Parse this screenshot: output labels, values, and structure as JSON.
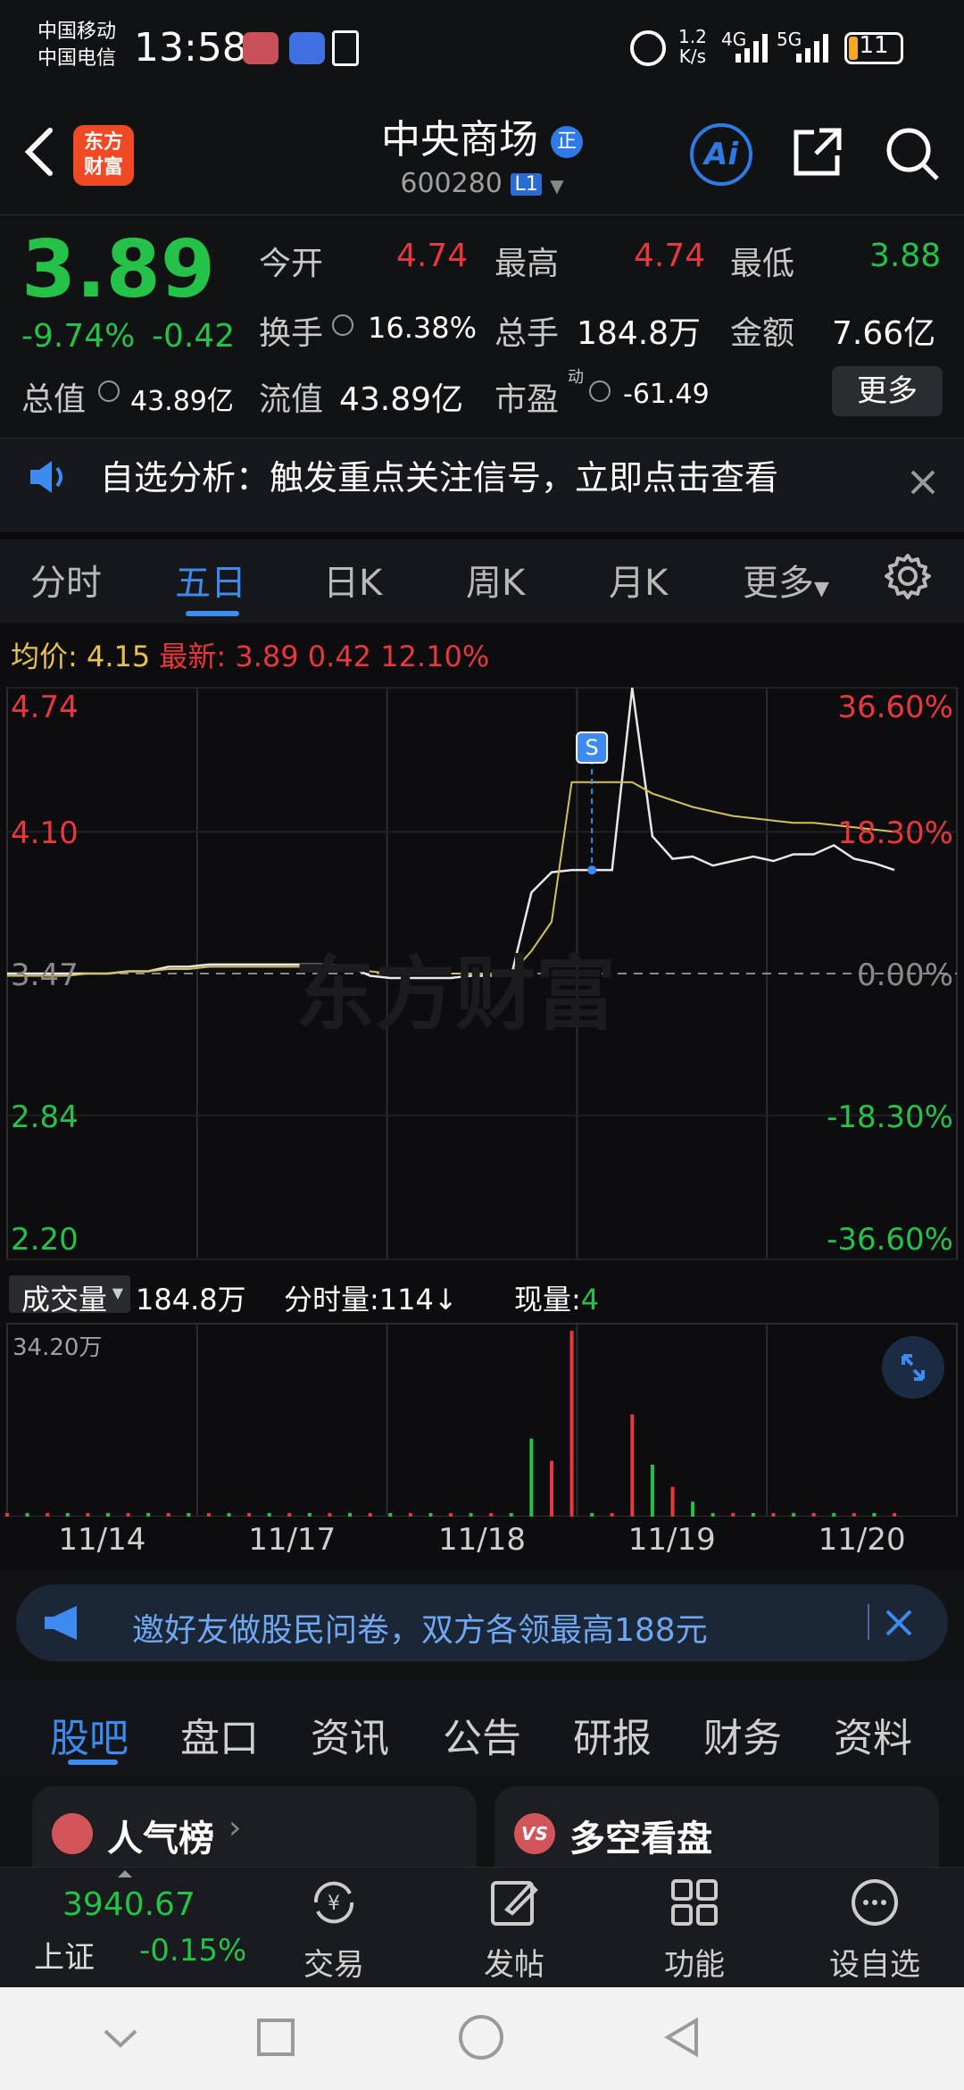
{
  "status_bar": {
    "carrier1": "中国移动",
    "carrier2": "中国电信",
    "time": "13:58",
    "net_speed_top": "1.2",
    "net_speed_bottom": "K/s",
    "net1": "4G",
    "net2": "5G",
    "battery": "11"
  },
  "header": {
    "logo_line1": "东方",
    "logo_line2": "财富",
    "title": "中央商场",
    "title_badge": "正",
    "code": "600280",
    "level_badge": "L1",
    "ai_label": "Ai"
  },
  "quote": {
    "price": "3.89",
    "change_pct": "-9.74%",
    "change_val": "-0.42",
    "open_label": "今开",
    "open": "4.74",
    "high_label": "最高",
    "high": "4.74",
    "low_label": "最低",
    "low": "3.88",
    "turnover_label": "换手",
    "turnover": "16.38%",
    "volume_label": "总手",
    "volume": "184.8万",
    "amount_label": "金额",
    "amount": "7.66亿",
    "total_mv_label": "总值",
    "total_mv": "43.89亿",
    "float_mv_label": "流值",
    "float_mv": "43.89亿",
    "pe_label": "市盈",
    "pe_sup": "动",
    "pe": "-61.49",
    "more_button": "更多"
  },
  "notice": {
    "text": "自选分析：触发重点关注信号，立即点击查看"
  },
  "chart_tabs": [
    "分时",
    "五日",
    "日K",
    "周K",
    "月K",
    "更多"
  ],
  "chart_info": {
    "avg_label": "均价:",
    "avg": "4.15",
    "latest_label": "最新:",
    "latest": "3.89",
    "latest_chg": "0.42",
    "latest_pct": "12.10%"
  },
  "chart_data": {
    "type": "line",
    "title": "",
    "x": [
      "11/14",
      "11/17",
      "11/18",
      "11/19",
      "11/20"
    ],
    "y_left_ticks": [
      "4.74",
      "4.10",
      "3.47",
      "2.84",
      "2.20"
    ],
    "y_right_ticks": [
      "36.60%",
      "18.30%",
      "0.00%",
      "-18.30%",
      "-36.60%"
    ],
    "ylim": [
      2.2,
      4.74
    ],
    "baseline": 3.47,
    "grid": true,
    "series": [
      {
        "color": "#e8e8e8",
        "values": [
          3.47,
          3.47,
          3.47,
          3.47,
          3.47,
          3.47,
          3.48,
          3.48,
          3.5,
          3.5,
          3.51,
          3.51,
          3.51,
          3.51,
          3.51,
          3.51,
          3.51,
          3.5,
          3.46,
          3.45,
          3.45,
          3.45,
          3.45,
          3.46,
          3.46,
          3.46,
          3.83,
          3.92,
          3.93,
          3.93,
          3.93,
          4.74,
          4.08,
          3.98,
          3.99,
          3.95,
          3.97,
          3.99,
          3.97,
          4.0,
          4.0,
          4.04,
          3.98,
          3.96,
          3.93
        ]
      },
      {
        "color": "#d4c25a",
        "values": [
          3.46,
          3.46,
          3.46,
          3.46,
          3.47,
          3.47,
          3.48,
          3.48,
          3.49,
          3.49,
          3.5,
          3.5,
          3.5,
          3.5,
          3.5,
          3.5,
          3.5,
          3.5,
          3.48,
          3.47,
          3.47,
          3.47,
          3.47,
          3.47,
          3.47,
          3.47,
          3.57,
          3.7,
          4.32,
          4.32,
          4.32,
          4.32,
          4.27,
          4.24,
          4.21,
          4.19,
          4.17,
          4.16,
          4.15,
          4.14,
          4.14,
          4.13,
          4.12,
          4.11,
          4.1
        ]
      }
    ],
    "marker": "S",
    "volume": {
      "label": "成交量",
      "total": "184.8万",
      "fen_label": "分时量:",
      "fen_val": "114↓",
      "now_label": "现量:",
      "now_val": "4",
      "ymax_label": "34.20万"
    }
  },
  "banner": {
    "text": "邀好友做股民问卷，双方各领最高188元"
  },
  "bottom_tabs": [
    "股吧",
    "盘口",
    "资讯",
    "公告",
    "研报",
    "财务",
    "资料"
  ],
  "cards": {
    "left": "人气榜",
    "right": "多空看盘",
    "right_badge": "VS"
  },
  "bottom_nav": {
    "index_value": "3940.67",
    "index_name": "上证",
    "index_change": "-0.15%",
    "trade": "交易",
    "post": "发帖",
    "function": "功能",
    "add_watch": "设自选"
  },
  "colors": {
    "up": "#e8383d",
    "down": "#25c24a",
    "accent": "#3d8bf0"
  }
}
